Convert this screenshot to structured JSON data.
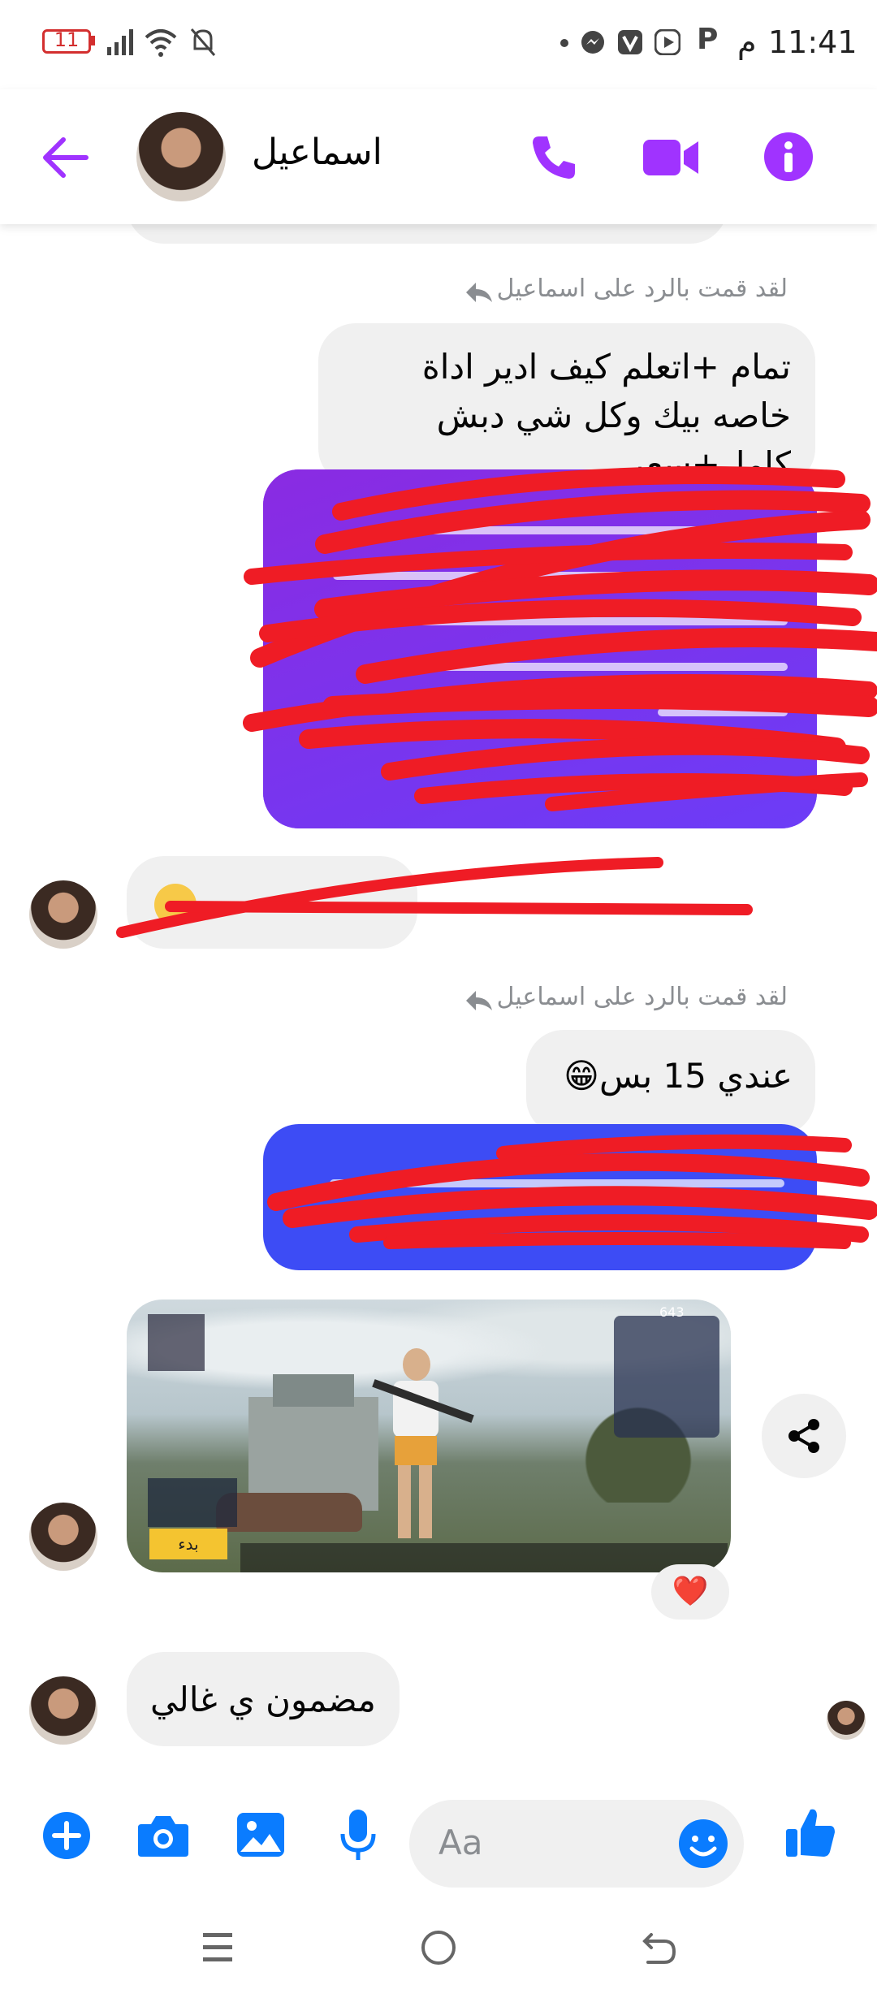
{
  "status_bar": {
    "time": "11:41",
    "am_pm": "م",
    "battery": "11"
  },
  "header": {
    "contact_name": "اسماعيل",
    "accent_color": "#a033ff"
  },
  "messages": {
    "reply_note_1": "لقد قمت بالرد على اسماعيل",
    "quoted_1": "تمام +اتعلم كيف ادير اداة خاصه بيك وكل شي دبش كامل+سعر",
    "reply_note_2": "لقد قمت بالرد على اسماعيل",
    "quoted_2": "عندي 15 بس😁",
    "received_last": "مضمون ي غالي",
    "sent_bubble_1_color": "#7a2cf5",
    "sent_bubble_2_color": "#3d4cf5",
    "reaction": "❤️"
  },
  "game_screenshot": {
    "start_button": "بدء",
    "coins": "643"
  },
  "composer": {
    "placeholder": "Aa"
  },
  "icons": {
    "back": "back-arrow-icon",
    "call": "phone-icon",
    "video": "video-camera-icon",
    "info": "info-icon",
    "share": "share-icon",
    "add": "plus-icon",
    "camera": "camera-icon",
    "gallery": "image-icon",
    "mic": "microphone-icon",
    "emoji": "emoji-icon",
    "like": "thumbs-up-icon"
  }
}
